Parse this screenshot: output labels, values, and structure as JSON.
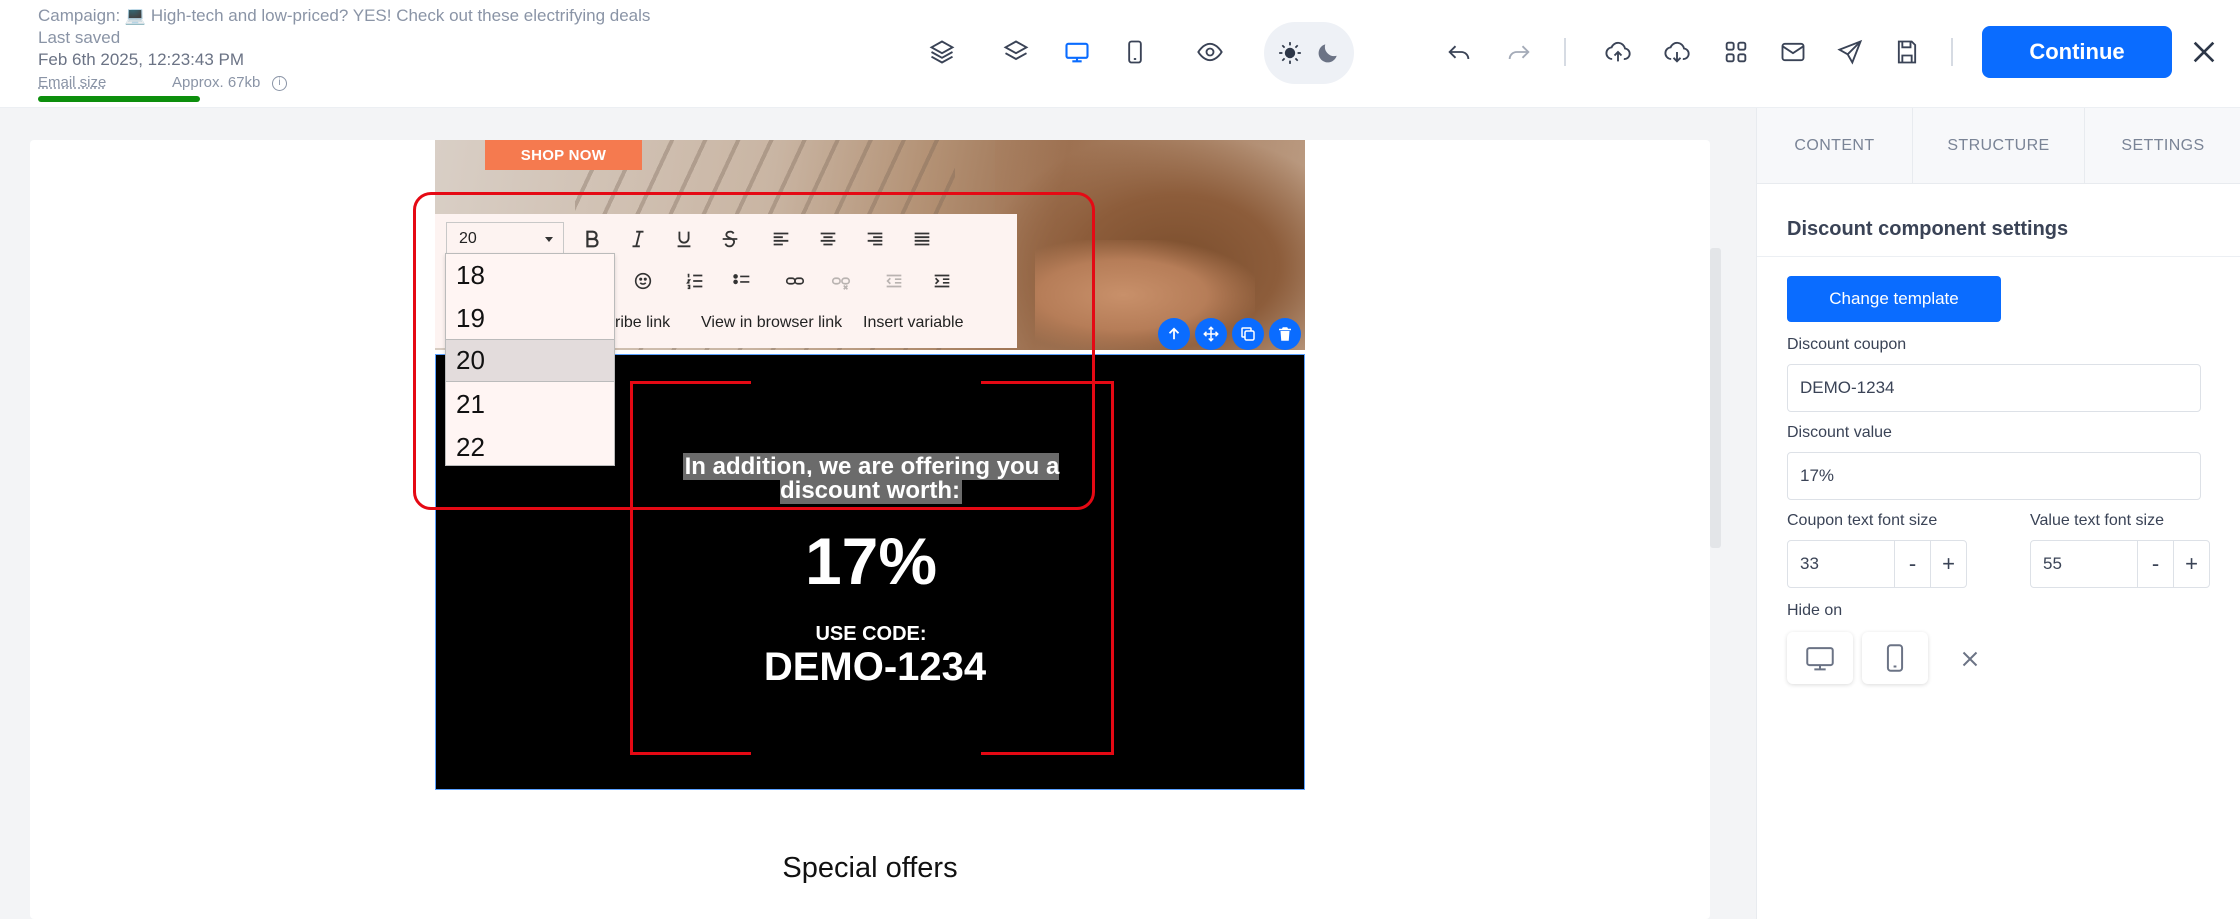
{
  "header": {
    "campaign_label": "Campaign: 💻 High-tech and low-priced? YES! Check out these electrifying deals",
    "last_saved_label": "Last saved",
    "last_saved_date": "Feb 6th 2025, 12:23:43 PM",
    "email_size_label": "Email size",
    "email_size_value": "Approx. 67kb",
    "continue_label": "Continue",
    "accent_color": "#0a6cff"
  },
  "email": {
    "shop_now": "SHOP NOW",
    "discount_heading": "In addition, we are offering you a discount worth:",
    "discount_value": "17%",
    "use_code": "USE CODE:",
    "coupon_code": "DEMO-1234",
    "special_offers": "Special offers"
  },
  "rte": {
    "font_size": "20",
    "font_size_options": [
      "18",
      "19",
      "20",
      "21",
      "22"
    ],
    "selected_option": "20",
    "links": {
      "unsubscribe": "cribe link",
      "browser": "View in browser link",
      "variable": "Insert variable"
    }
  },
  "panel": {
    "tabs": [
      "CONTENT",
      "STRUCTURE",
      "SETTINGS"
    ],
    "title": "Discount component settings",
    "change_template": "Change template",
    "coupon_label": "Discount coupon",
    "coupon_value": "DEMO-1234",
    "value_label": "Discount value",
    "value_value": "17%",
    "coupon_font_label": "Coupon text font size",
    "coupon_font_value": "33",
    "value_font_label": "Value text font size",
    "value_font_value": "55",
    "minus": "-",
    "plus": "+",
    "hide_on_label": "Hide on"
  }
}
